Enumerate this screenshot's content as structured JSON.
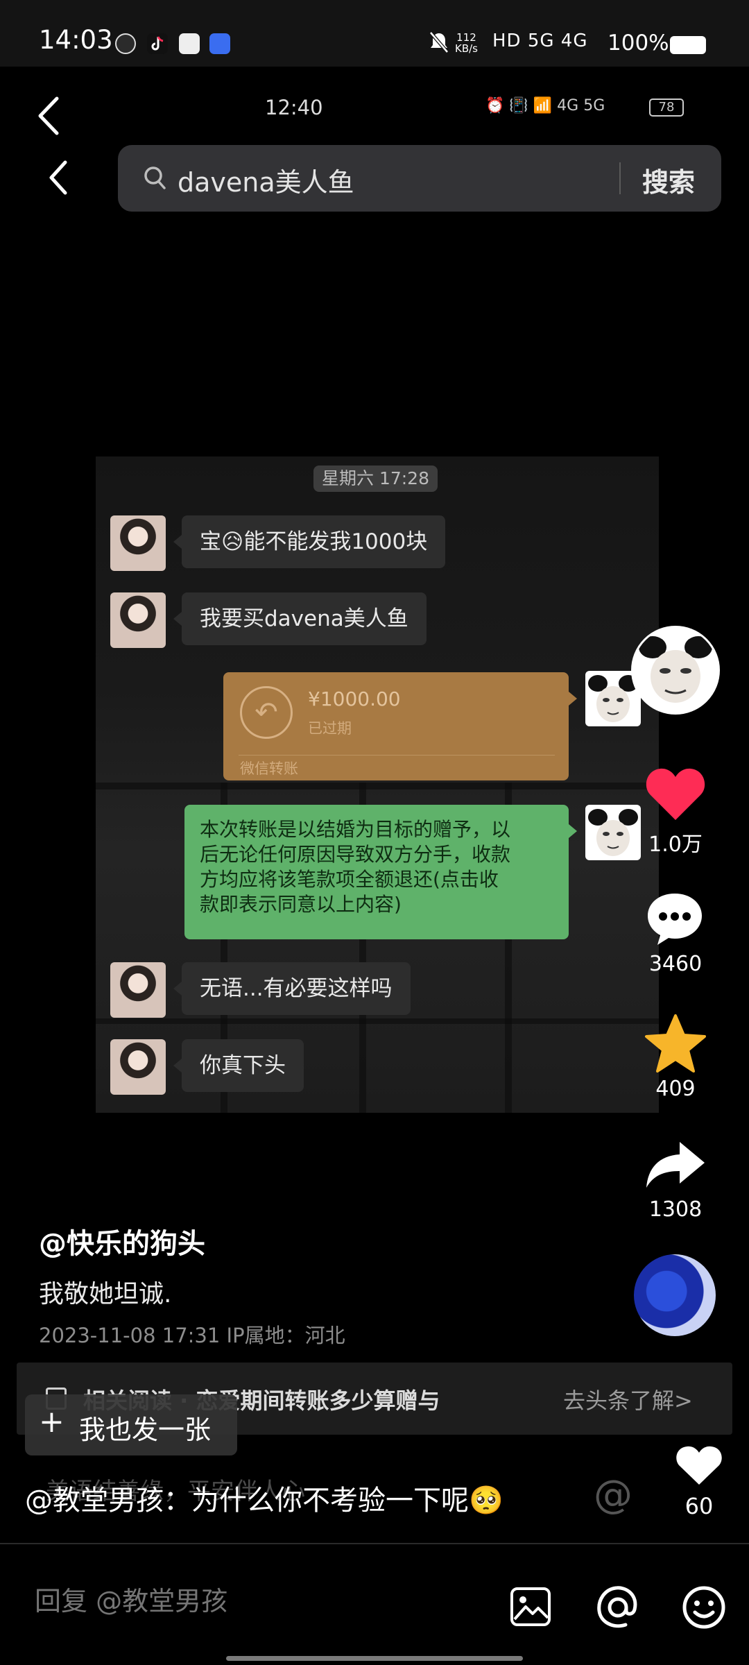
{
  "status_bar": {
    "time": "14:03",
    "net_speed_value": "112",
    "net_speed_unit": "KB/s",
    "network": "HD 5G 4G",
    "battery": "100%"
  },
  "inner_screenshot": {
    "time": "12:40",
    "status_icons": "⏰ 📳 📶 4G 5G",
    "battery": "78",
    "search_query": "davena美人鱼",
    "search_button": "搜索"
  },
  "chat": {
    "date_label": "星期六 17:28",
    "msg1": "宝😥能不能发我1000块",
    "msg2": "我要买davena美人鱼",
    "transfer_amount": "¥1000.00",
    "transfer_status": "已过期",
    "transfer_label": "微信转账",
    "green_line1": "本次转账是以结婚为目标的赠予，以",
    "green_line2": "后无论任何原因导致双方分手，收款",
    "green_line3": "方均应将该笔款项全额退还(点击收",
    "green_line4": "款即表示同意以上内容)",
    "msg3": "无语...有必要这样吗",
    "msg4": "你真下头"
  },
  "actions": {
    "likes": "1.0万",
    "comments": "3460",
    "favorites": "409",
    "shares": "1308"
  },
  "caption": {
    "author": "@快乐的狗头",
    "text": "我敬她坦诚.",
    "meta": "2023-11-08 17:31   IP属地：河北"
  },
  "related": {
    "text": "相关阅读 · 恋爱期间转账多少算赠与",
    "link": "去头条了解>"
  },
  "post_button": "我也发一张",
  "underlying_comment": "美语结善缘，平安伴人心",
  "reply_comment": {
    "text": "@教堂男孩：为什么你不考验一下呢🥺",
    "likes": "60"
  },
  "reply_input": {
    "placeholder": "回复 @教堂男孩"
  },
  "colors": {
    "like_red": "#fe2c55",
    "star_yellow": "#f7b52a",
    "green_bubble": "#5fb26a",
    "transfer_orange": "#a87a43"
  }
}
